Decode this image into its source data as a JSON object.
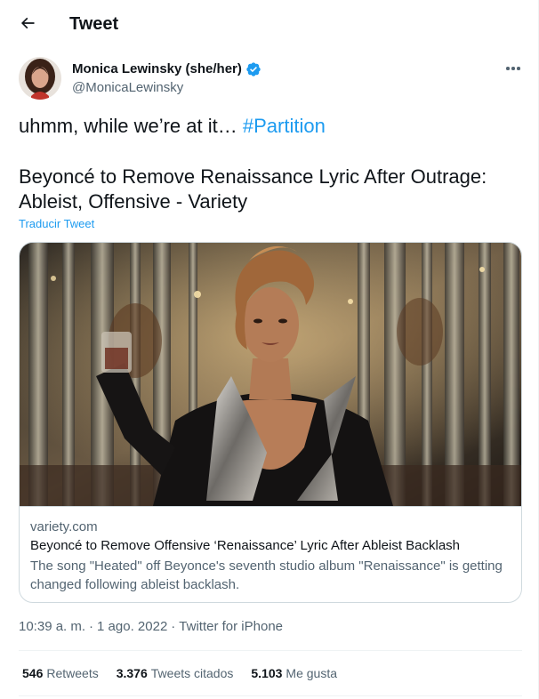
{
  "header": {
    "title": "Tweet",
    "back_icon": "arrow-left-icon"
  },
  "author": {
    "name": "Monica Lewinsky (she/her)",
    "handle": "@MonicaLewinsky",
    "verified": true,
    "verified_color": "#1d9bf0"
  },
  "tweet": {
    "text": "uhmm, while we’re at it…",
    "hashtag": "#Partition",
    "headline": "Beyoncé to Remove Renaissance Lyric After Outrage: Ableist, Offensive - Variety",
    "translate_label": "Traducir Tweet"
  },
  "card": {
    "domain": "variety.com",
    "title": "Beyoncé to Remove Offensive ‘Renaissance’ Lyric After Ableist Backlash",
    "description": "The song \"Heated\" off Beyonce's seventh studio album \"Renaissance\" is getting changed following ableist backlash."
  },
  "meta": {
    "time": "10:39 a. m.",
    "dot1": "·",
    "date": "1 ago. 2022",
    "dot2": "·",
    "source": "Twitter for iPhone"
  },
  "stats": {
    "retweets": {
      "count": "546",
      "label": "Retweets"
    },
    "quotes": {
      "count": "3.376",
      "label": "Tweets citados"
    },
    "likes": {
      "count": "5.103",
      "label": "Me gusta"
    }
  },
  "colors": {
    "accent": "#1d9bf0",
    "text": "#0f1419",
    "secondary": "#536471",
    "border": "#cfd9de"
  }
}
